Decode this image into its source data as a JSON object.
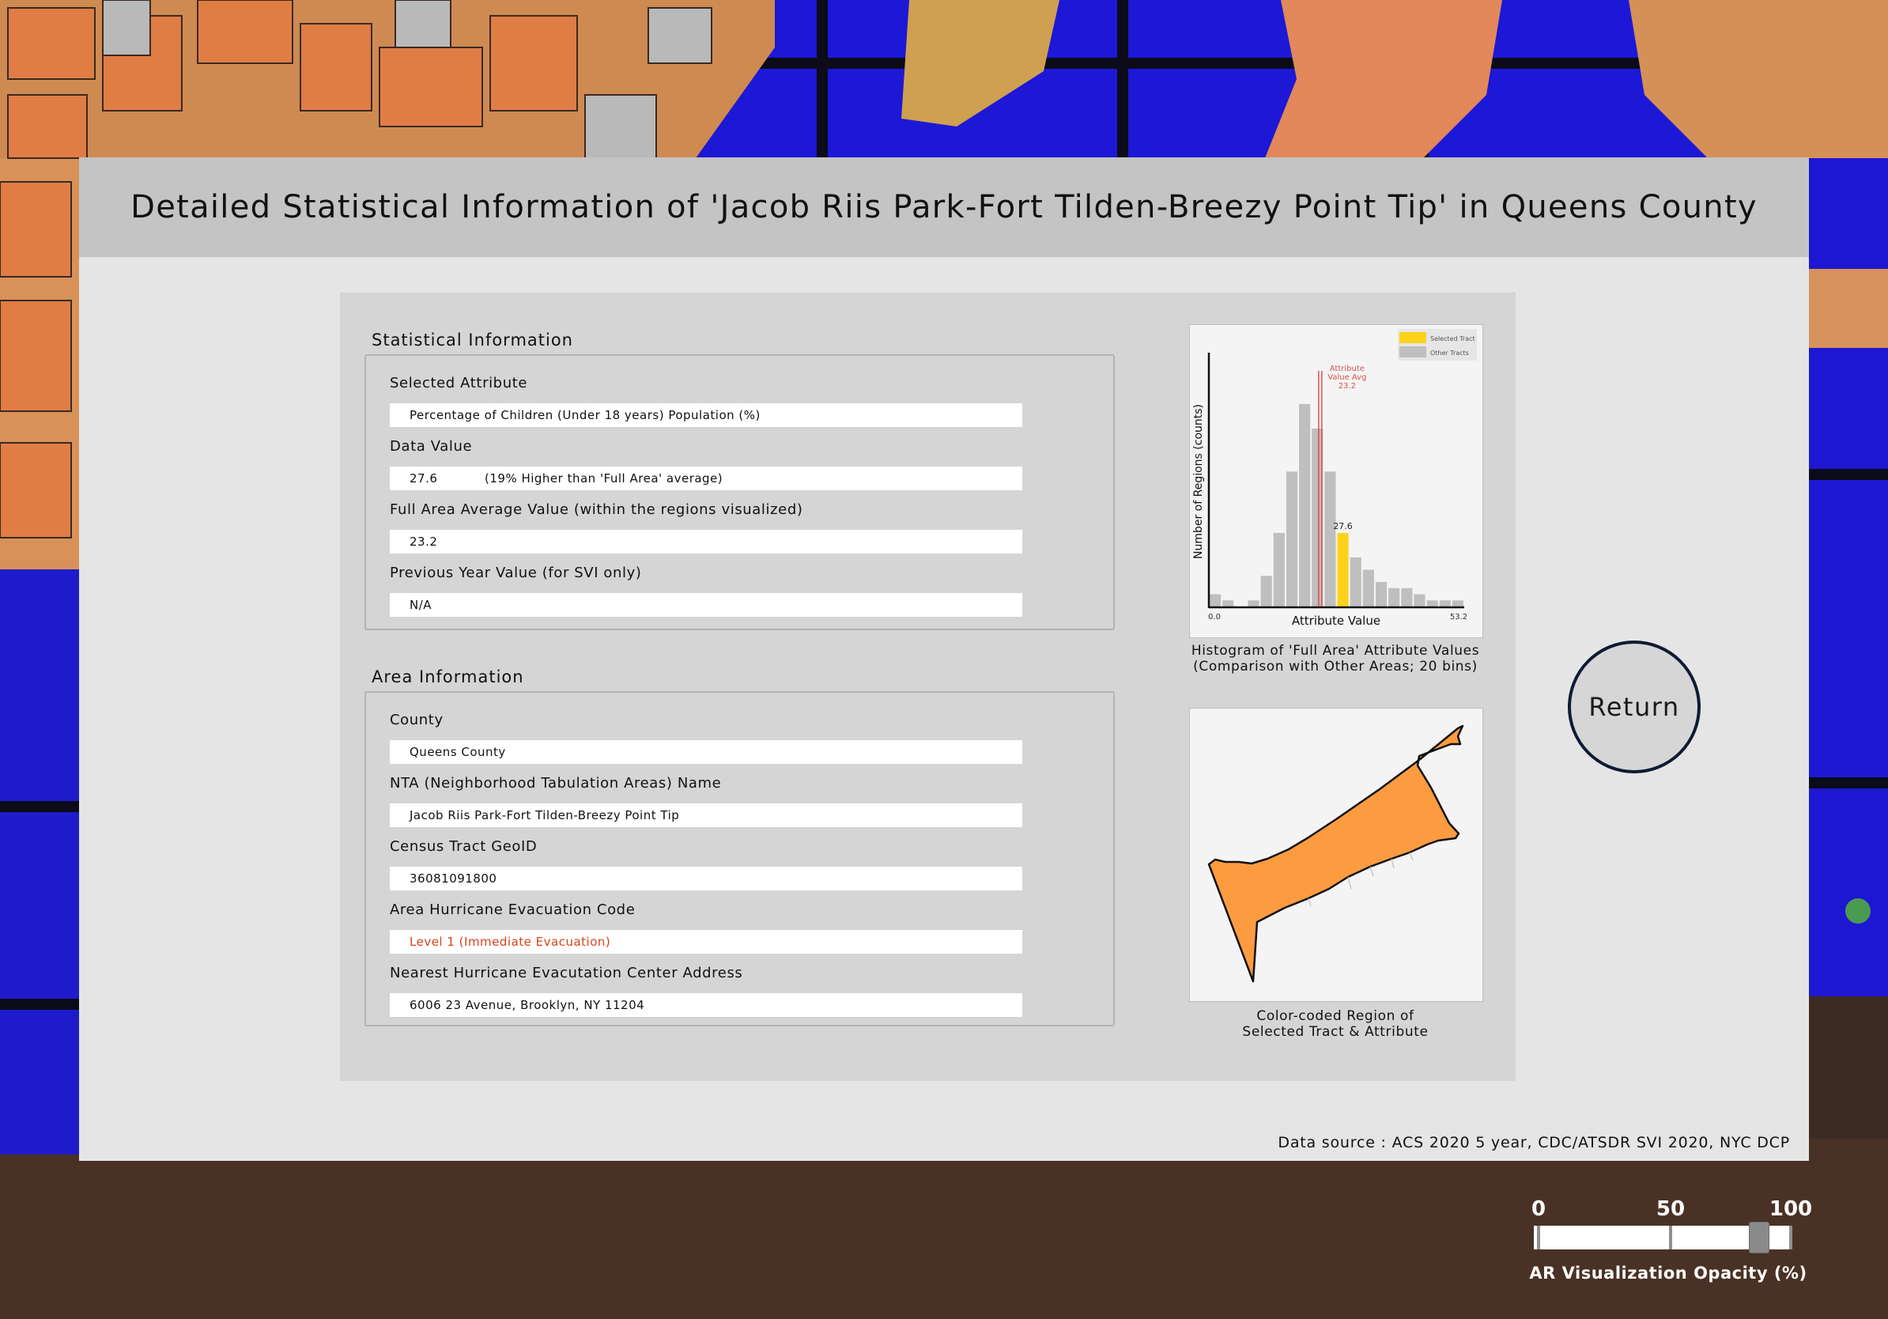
{
  "title": "Detailed Statistical Information of 'Jacob Riis Park-Fort Tilden-Breezy Point Tip' in Queens County",
  "statistical_info": {
    "heading": "Statistical Information",
    "fields": [
      {
        "label": "Selected Attribute",
        "value": "Percentage of Children (Under 18 years) Population (%)"
      },
      {
        "label": "Data Value",
        "value": "27.6",
        "note": "(19% Higher than 'Full Area' average)"
      },
      {
        "label": "Full Area Average Value (within the regions visualized)",
        "value": "23.2"
      },
      {
        "label": "Previous Year Value (for SVI only)",
        "value": "N/A"
      }
    ]
  },
  "area_info": {
    "heading": "Area Information",
    "fields": [
      {
        "label": "County",
        "value": "Queens County"
      },
      {
        "label": "NTA (Neighborhood Tabulation Areas) Name",
        "value": "Jacob Riis Park-Fort Tilden-Breezy Point Tip"
      },
      {
        "label": "Census Tract GeoID",
        "value": "36081091800"
      },
      {
        "label": "Area Hurricane Evacuation Code",
        "value": "Level 1 (Immediate Evacuation)",
        "highlight": "#d9431b"
      },
      {
        "label": "Nearest Hurricane Evacutation Center Address",
        "value": "6006 23 Avenue, Brooklyn, NY 11204"
      }
    ]
  },
  "histogram_caption_line1": "Histogram of 'Full Area' Attribute Values",
  "histogram_caption_line2": "(Comparison with Other Areas; 20 bins)",
  "map_caption_line1": "Color-coded Region of",
  "map_caption_line2": "Selected Tract & Attribute",
  "data_source": "Data source : ACS 2020 5 year, CDC/ATSDR SVI 2020, NYC DCP",
  "return_button": "Return",
  "opacity_slider": {
    "label": "AR Visualization Opacity (%)",
    "tick_labels": [
      "0",
      "50",
      "100"
    ],
    "min": 0,
    "max": 100,
    "value": 88
  },
  "chart_data": {
    "type": "bar",
    "title": "",
    "xlabel": "Attribute Value",
    "ylabel": "Number of Regions (counts)",
    "x_tick_labels": [
      "0.0",
      "53.2"
    ],
    "xlim": [
      0,
      53.2
    ],
    "bins": 20,
    "values": [
      2,
      1,
      0,
      1,
      5,
      12,
      22,
      33,
      29,
      22,
      12,
      8,
      6,
      4,
      3,
      3,
      2,
      1,
      1,
      1
    ],
    "selected_value": 27.6,
    "selected_label": "27.6",
    "average_value": 23.2,
    "average_label_lines": [
      "Attribute",
      "Value Avg",
      "23.2"
    ],
    "legend": [
      "Selected Tract",
      "Other Tracts"
    ],
    "legend_position": "top-right",
    "colors": {
      "selected": "#ffd21a",
      "other": "#bfbfbf",
      "average_line": "#d9534f"
    },
    "grid": false
  },
  "colors": {
    "tract_fill": "#fd9b40",
    "return_border": "#0f1a33",
    "ar_water": "#1f17d6",
    "ar_land": "#e58a4e"
  }
}
